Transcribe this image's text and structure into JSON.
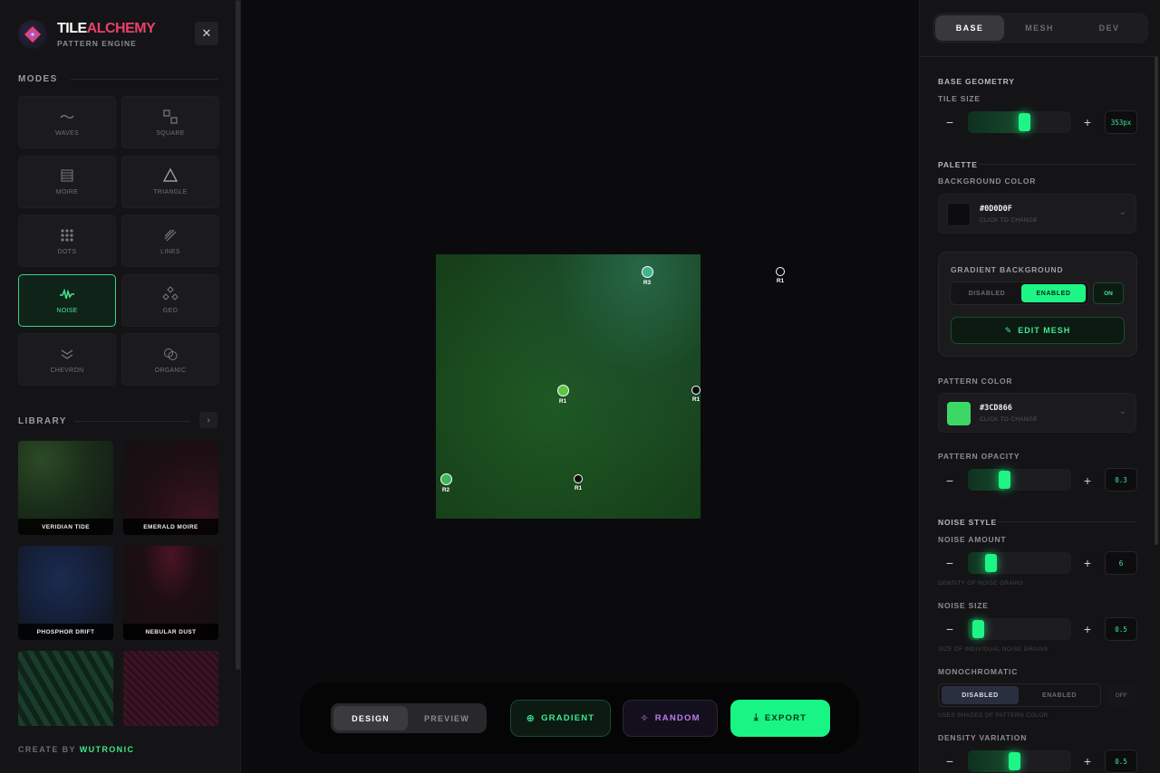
{
  "brand": {
    "title_white": "TILE",
    "title_red": "ALCHEMY",
    "subtitle": "PATTERN ENGINE",
    "close_glyph": "✕"
  },
  "modes": {
    "heading": "MODES",
    "items": [
      {
        "label": "WAVES",
        "icon": "wave-icon"
      },
      {
        "label": "SQUARE",
        "icon": "squares-icon"
      },
      {
        "label": "MOIRE",
        "icon": "moire-icon"
      },
      {
        "label": "TRIANGLE",
        "icon": "triangle-icon"
      },
      {
        "label": "DOTS",
        "icon": "dots-grid-icon"
      },
      {
        "label": "LINES",
        "icon": "diagonal-lines-icon"
      },
      {
        "label": "NOISE",
        "icon": "noise-pulse-icon",
        "active": true
      },
      {
        "label": "GEO",
        "icon": "geo-diamonds-icon"
      },
      {
        "label": "CHEVRON",
        "icon": "chevron-icon"
      },
      {
        "label": "ORGANIC",
        "icon": "organic-circles-icon"
      }
    ]
  },
  "library": {
    "heading": "LIBRARY",
    "next_glyph": "›",
    "items": [
      {
        "label": "VERIDIAN TIDE"
      },
      {
        "label": "EMERALD MOIRE"
      },
      {
        "label": "PHOSPHOR DRIFT"
      },
      {
        "label": "NEBULAR DUST"
      },
      {
        "label": ""
      },
      {
        "label": ""
      }
    ]
  },
  "credit": {
    "prefix": "CREATE BY",
    "brand": "WUTRONIC"
  },
  "canvas": {
    "mesh_points": [
      {
        "label": "R3",
        "fill": "#3fb591",
        "in_tile": true
      },
      {
        "label": "R1",
        "fill": "#0b0b0d",
        "in_tile": false
      },
      {
        "label": "R1",
        "fill": "#5fc444",
        "in_tile": true
      },
      {
        "label": "R1",
        "fill": "#0b0b0d",
        "in_tile": false
      },
      {
        "label": "R2",
        "fill": "#3fb55c",
        "in_tile": true
      },
      {
        "label": "R1",
        "fill": "#0b0b0d",
        "in_tile": false
      }
    ]
  },
  "toolbar": {
    "design": "DESIGN",
    "preview": "PREVIEW",
    "gradient": "GRADIENT",
    "random": "RANDOM",
    "export": "EXPORT",
    "gradient_icon": "⊕",
    "random_icon": "✧",
    "export_icon": "⤓"
  },
  "panel": {
    "tabs": [
      "BASE",
      "MESH",
      "DEV"
    ],
    "base_geometry": "BASE GEOMETRY",
    "tile_size": {
      "label": "TILE SIZE",
      "value": "353px",
      "level": 0.55
    },
    "palette": "PALETTE",
    "background_color": {
      "label": "BACKGROUND COLOR",
      "hex": "#0D0D0F",
      "hint": "CLICK TO CHANGE",
      "swatch": "#0d0d0f"
    },
    "gradient_bg": {
      "label": "GRADIENT BACKGROUND",
      "disabled": "DISABLED",
      "enabled": "ENABLED",
      "state": "ON",
      "edit": "EDIT MESH",
      "edit_icon": "✎"
    },
    "pattern_color": {
      "label": "PATTERN COLOR",
      "hex": "#3CD866",
      "hint": "CLICK TO CHANGE",
      "swatch": "#3cd866"
    },
    "pattern_opacity": {
      "label": "PATTERN OPACITY",
      "value": "0.3",
      "level": 0.34
    },
    "noise_style": "NOISE STYLE",
    "noise_amount": {
      "label": "NOISE AMOUNT",
      "value": "6",
      "help": "DENSITY OF NOISE GRAINS",
      "level": 0.19
    },
    "noise_size": {
      "label": "NOISE SIZE",
      "value": "0.5",
      "help": "SIZE OF INDIVIDUAL NOISE GRAINS",
      "level": 0.05
    },
    "monochromatic": {
      "label": "MONOCHROMATIC",
      "disabled": "DISABLED",
      "enabled": "ENABLED",
      "state": "OFF",
      "help": "USES SHADES OF PATTERN COLOR"
    },
    "density_variation": {
      "label": "DENSITY VARIATION",
      "value": "0.5",
      "level": 0.45
    },
    "minus": "−",
    "plus": "+",
    "chevron": "⌄"
  },
  "colors": {
    "accent": "#1df585",
    "accent_text": "#3fe890",
    "brand_red": "#e8416b",
    "random_purple": "#b77ef0"
  }
}
